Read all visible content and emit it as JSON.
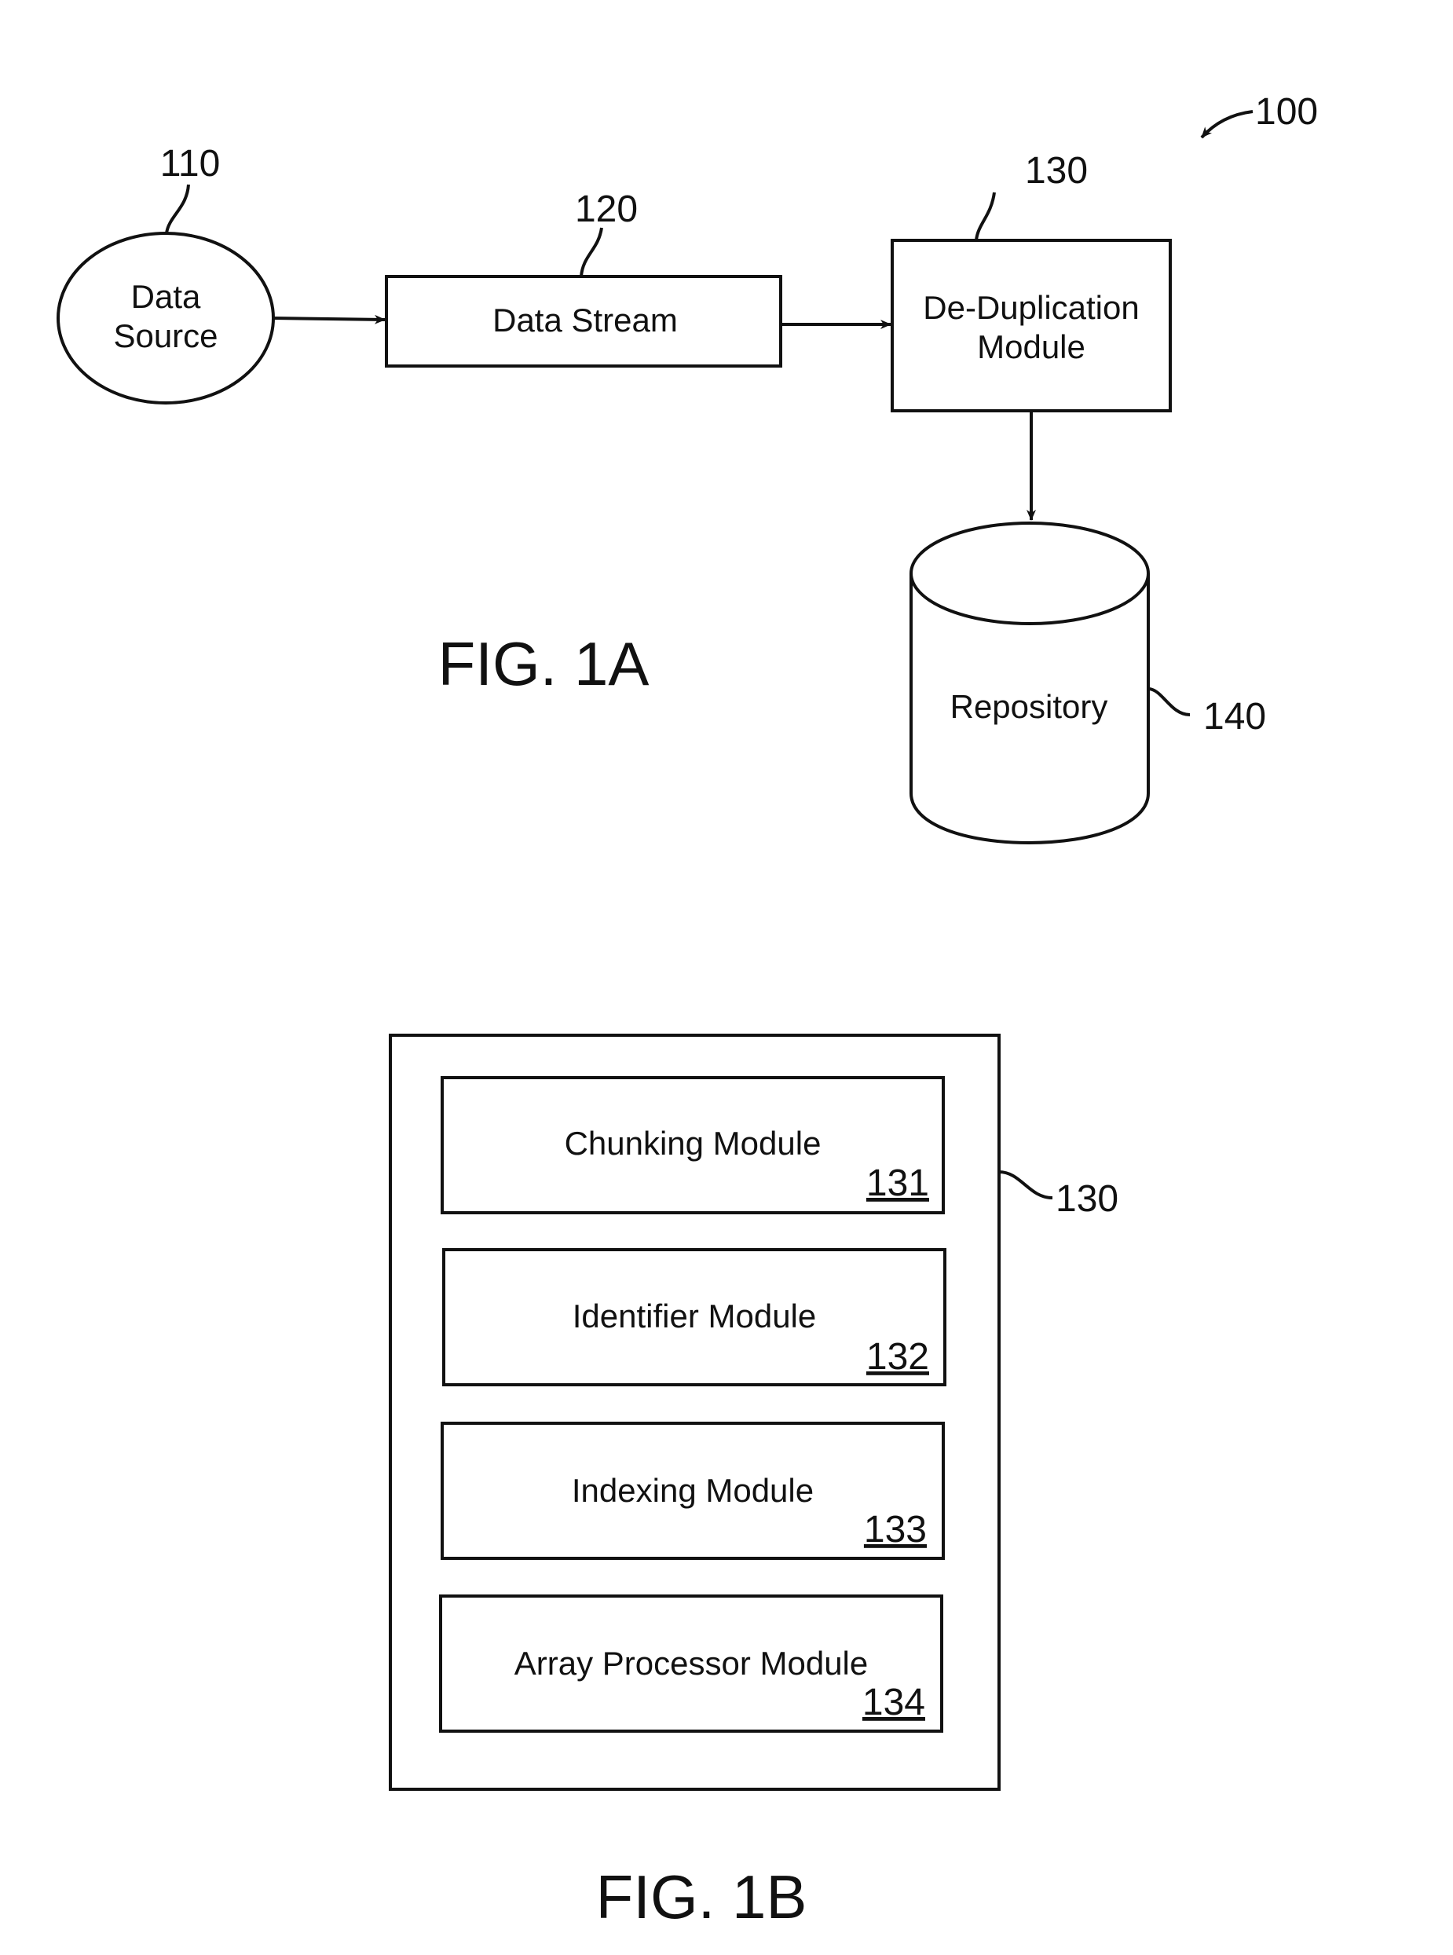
{
  "figure_1a": {
    "caption": "FIG. 1A",
    "system_ref": "100",
    "data_source": {
      "label_line1": "Data",
      "label_line2": "Source",
      "ref": "110"
    },
    "data_stream": {
      "label": "Data Stream",
      "ref": "120"
    },
    "dedup_module": {
      "label_line1": "De-Duplication",
      "label_line2": "Module",
      "ref": "130"
    },
    "repository": {
      "label": "Repository",
      "ref": "140"
    }
  },
  "figure_1b": {
    "caption": "FIG. 1B",
    "container_ref": "130",
    "modules": [
      {
        "label": "Chunking Module",
        "ref": "131"
      },
      {
        "label": "Identifier Module",
        "ref": "132"
      },
      {
        "label": "Indexing Module",
        "ref": "133"
      },
      {
        "label": "Array Processor Module",
        "ref": "134"
      }
    ]
  }
}
